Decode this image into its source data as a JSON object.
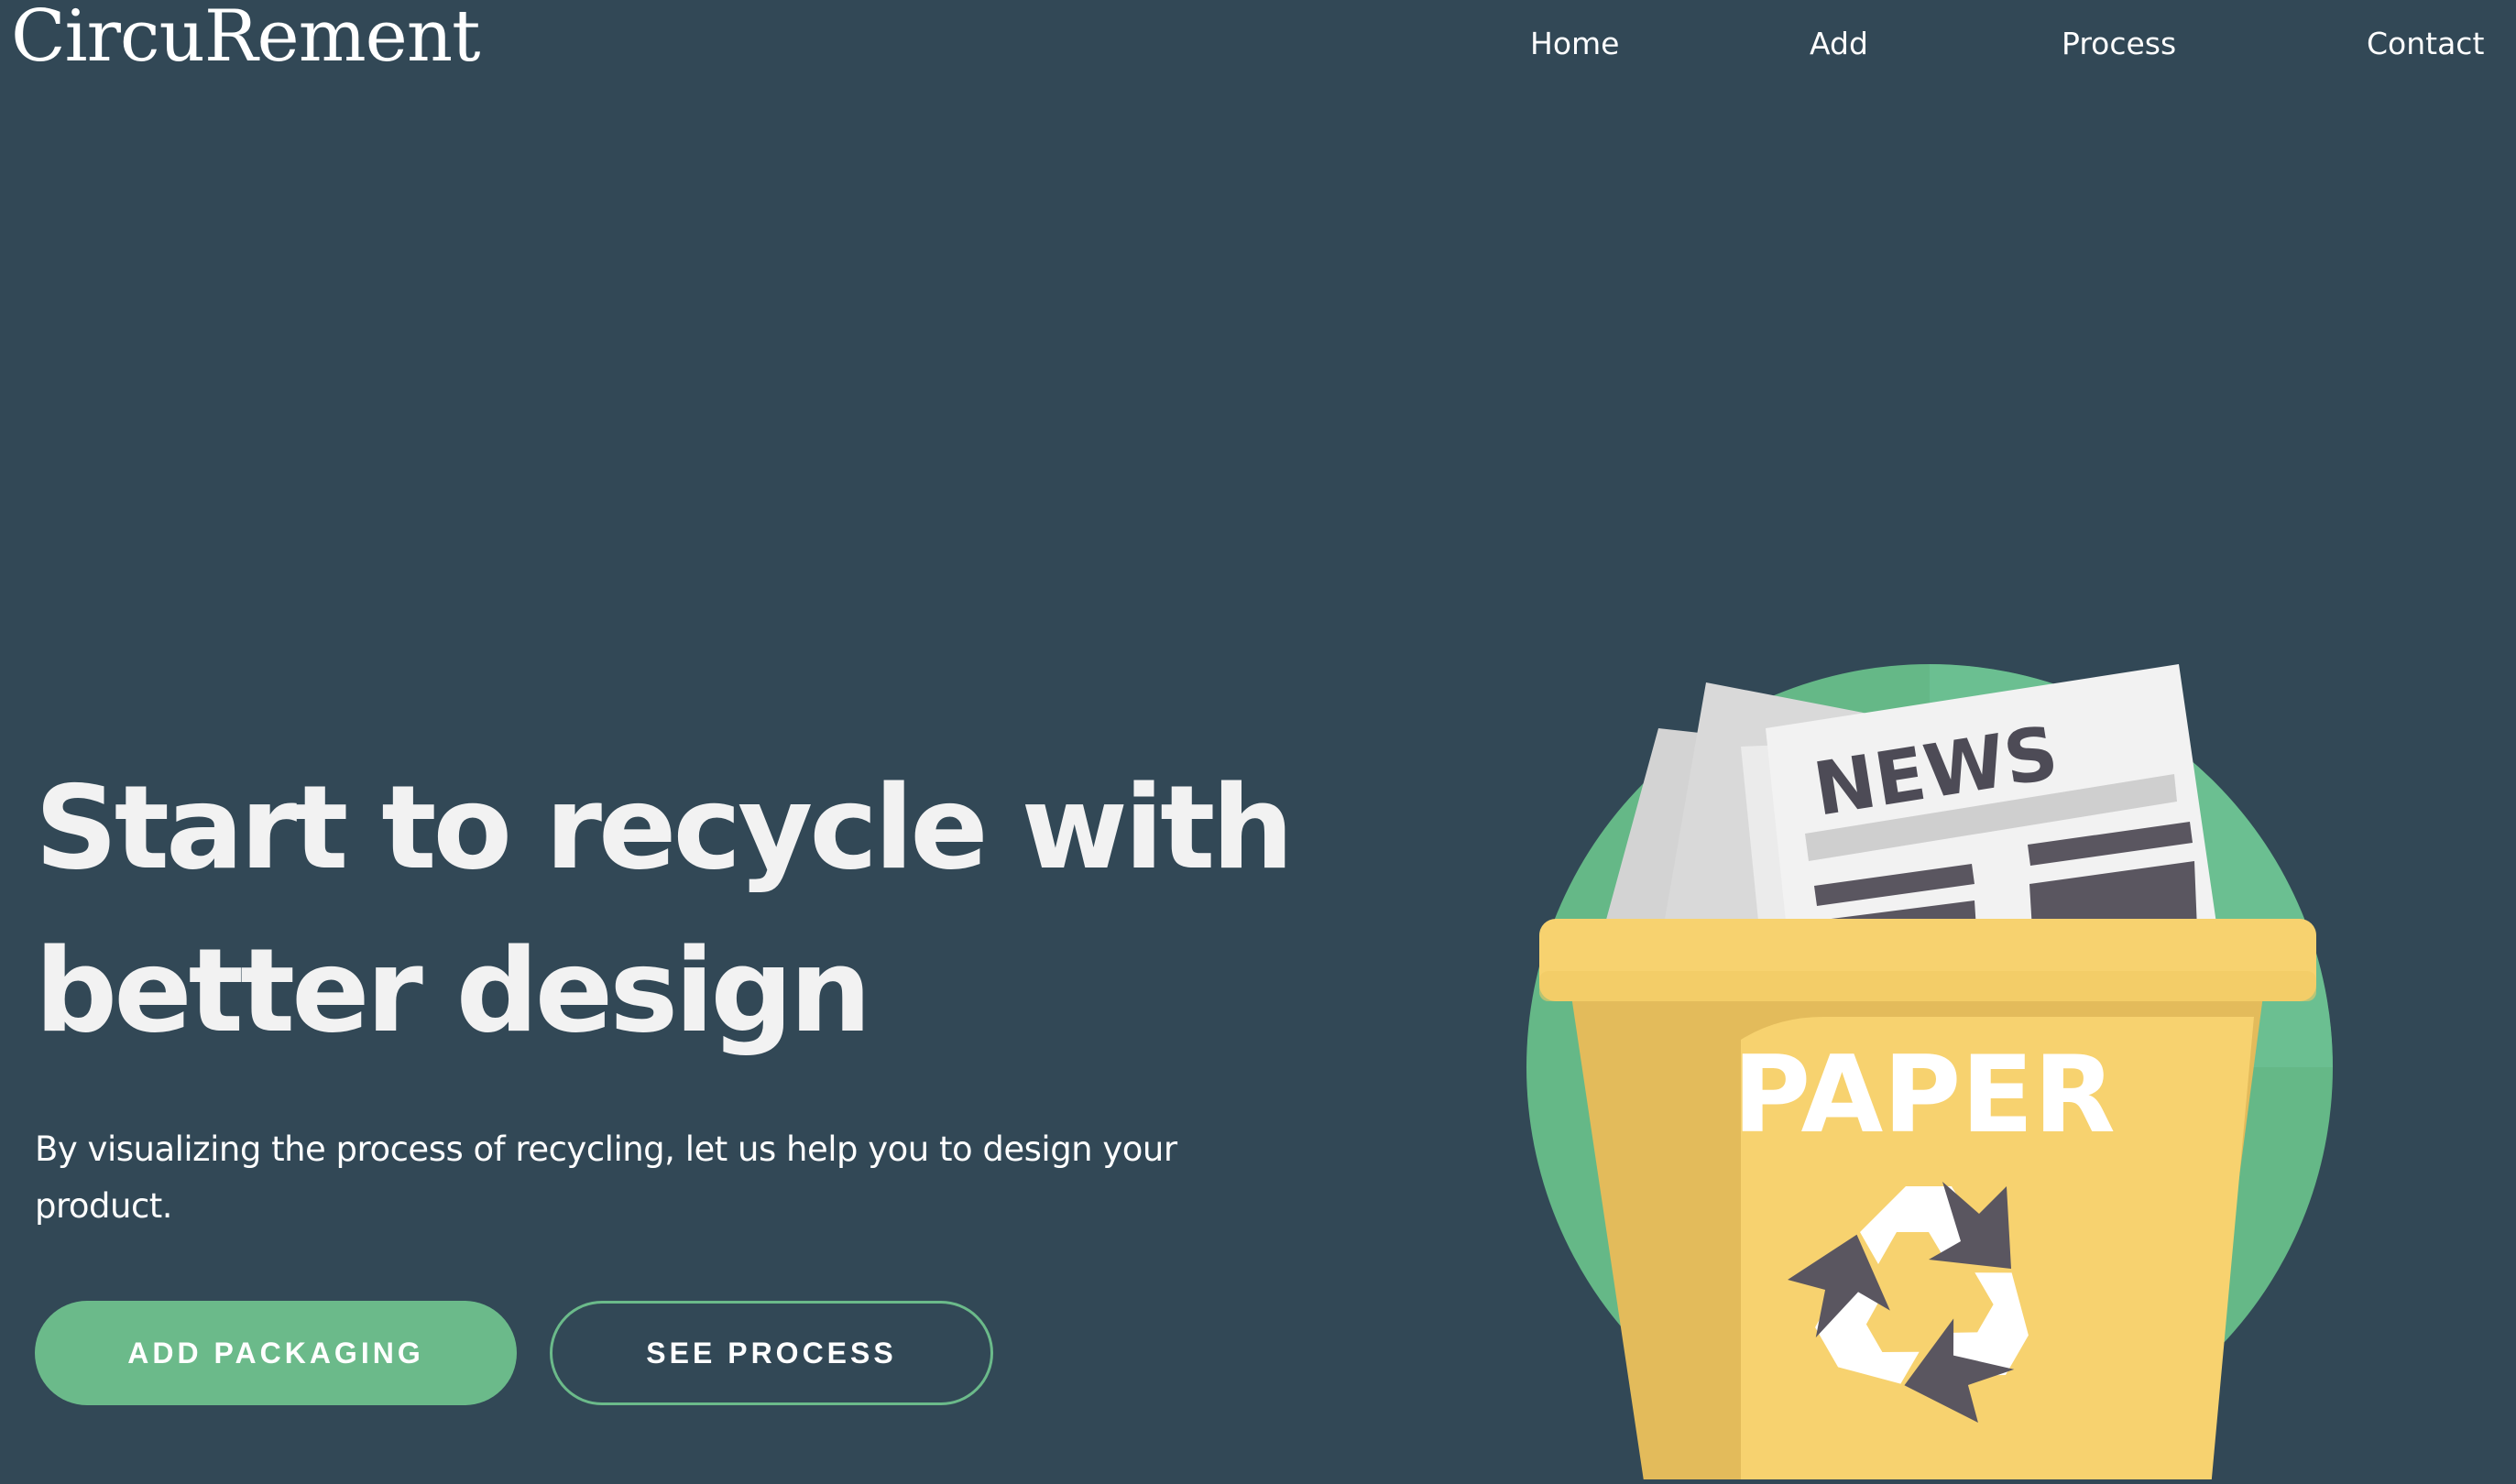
{
  "header": {
    "brand": "CircuRement",
    "nav": [
      {
        "label": "Home"
      },
      {
        "label": "Add"
      },
      {
        "label": "Process"
      },
      {
        "label": "Contact"
      }
    ]
  },
  "hero": {
    "title": "Start to recycle with better design",
    "subtitle": "By visualizing the process of recycling, let us help you to design your product.",
    "primary_button": "ADD PACKAGING",
    "secondary_button": "SEE PROCESS"
  },
  "illustration": {
    "newspaper_label": "NEWS",
    "bin_label": "PAPER",
    "icon": "recycle-icon"
  },
  "colors": {
    "background": "#324856",
    "accent": "#6bba8a",
    "bin_yellow": "#f7d26f",
    "circle_green": "#6bba8a"
  }
}
